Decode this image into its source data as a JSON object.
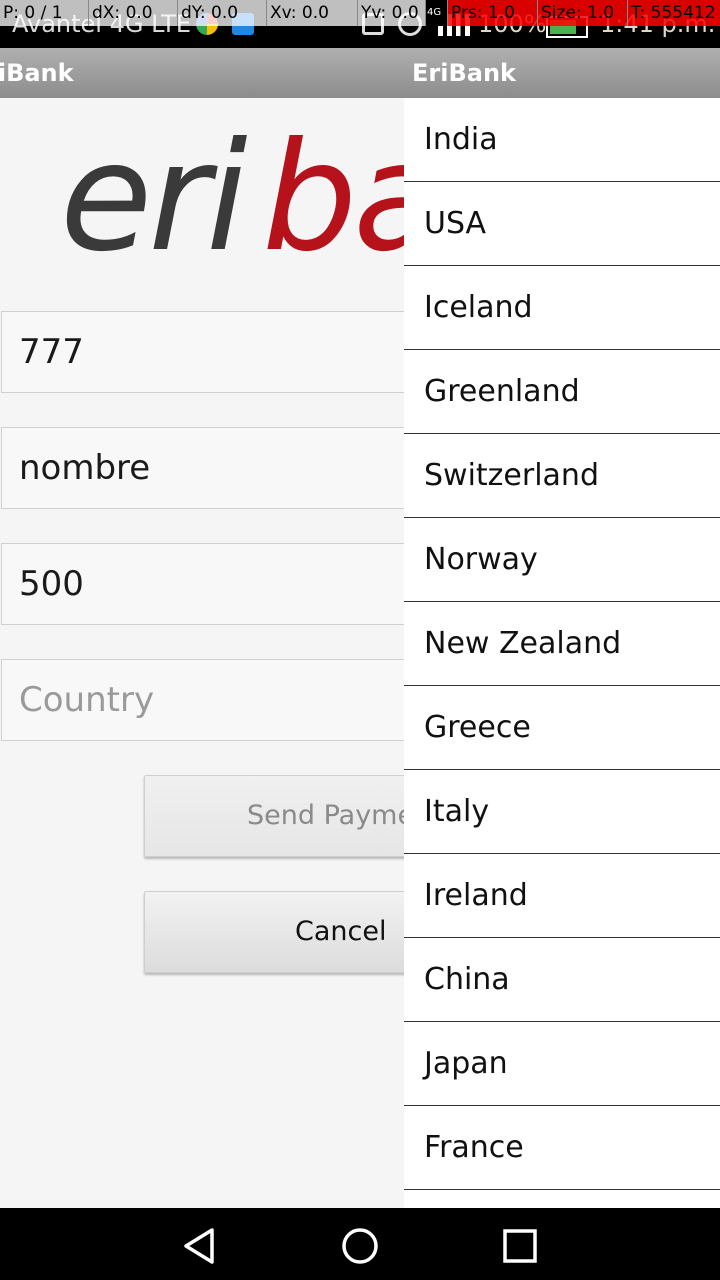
{
  "status_bar": {
    "carrier": "Avantel 4G LTE",
    "battery_percent": "100%",
    "clock": "1:41 p.m.",
    "network_label": "4G"
  },
  "pointer_location": {
    "p": "P: 0 / 1",
    "dx": "dX: 0.0",
    "dy": "dY: 0.0",
    "xv": "Xv: 0.0",
    "yv": "Yv: 0.0",
    "prs": "Prs: 1.0",
    "size": "Size: 1.0",
    "t": "T: 555412"
  },
  "app": {
    "title_background": "riBank",
    "title_dropdown": "EriBank",
    "logo_dark": "eri",
    "logo_red": "ba"
  },
  "form": {
    "phone_value": "777",
    "name_value": "nombre",
    "amount_value": "500",
    "country_placeholder": "Country",
    "send_payment_label": "Send Payme",
    "cancel_label": "Cancel"
  },
  "countries": [
    "India",
    "USA",
    "Iceland",
    "Greenland",
    "Switzerland",
    "Norway",
    "New Zealand",
    "Greece",
    "Italy",
    "Ireland",
    "China",
    "Japan",
    "France"
  ],
  "colors": {
    "brand_red": "#b5121b",
    "brand_dark": "#3a3a3a",
    "actionbar": "#9e9e9e"
  }
}
